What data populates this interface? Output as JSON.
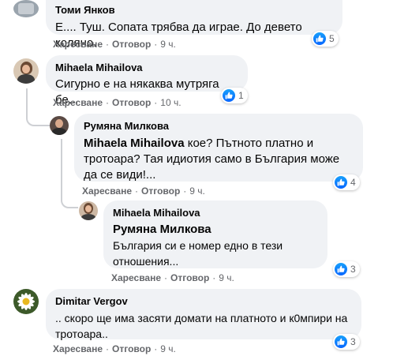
{
  "comments": [
    {
      "author": "Томи Янков",
      "text": "Е.... Туш. Сопата трябва да играе. До девето коляно.",
      "like": "Харесване",
      "reply": "Отговор",
      "time": "9 ч.",
      "reactions": "5"
    },
    {
      "author": "Mihaela Mihailova",
      "text": "Сигурно е на някаква мутряга бе...",
      "like": "Харесване",
      "reply": "Отговор",
      "time": "10 ч.",
      "reactions": "1"
    },
    {
      "author": "Румяна Милкова",
      "mention": "Mihaela Mihailova",
      "text": " кое? Пътното платно и тротоара? Тая идиотия само в България може да се види!...",
      "like": "Харесване",
      "reply": "Отговор",
      "time": "9 ч.",
      "reactions": "4"
    },
    {
      "author": "Mihaela Mihailova",
      "mention": "Румяна Милкова",
      "text": "България си е номер едно в тези отношения...",
      "like": "Харесване",
      "reply": "Отговор",
      "time": "9 ч.",
      "reactions": "3"
    },
    {
      "author": "Dimitar Vergov",
      "text": ".. скоро ще има засяти домати на платното и к0мпири на тротоара..",
      "like": "Харесване",
      "reply": "Отговор",
      "time": "9 ч.",
      "reactions": "3"
    }
  ],
  "colors": {
    "bubble": "#f0f2f5",
    "meta": "#65676b",
    "like_blue": "#0866ff"
  }
}
